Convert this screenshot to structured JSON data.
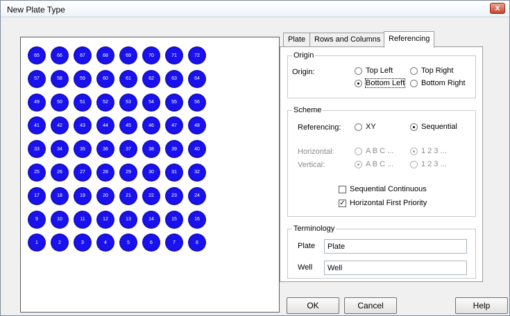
{
  "window": {
    "title": "New Plate Type",
    "close_label": "x"
  },
  "plate": {
    "rows": [
      [
        "65",
        "66",
        "67",
        "68",
        "69",
        "70",
        "71",
        "72"
      ],
      [
        "57",
        "58",
        "59",
        "60",
        "61",
        "62",
        "63",
        "64"
      ],
      [
        "49",
        "50",
        "51",
        "52",
        "53",
        "54",
        "55",
        "56"
      ],
      [
        "41",
        "42",
        "43",
        "44",
        "45",
        "46",
        "47",
        "48"
      ],
      [
        "33",
        "34",
        "35",
        "36",
        "37",
        "38",
        "39",
        "40"
      ],
      [
        "25",
        "26",
        "27",
        "28",
        "29",
        "30",
        "31",
        "32"
      ],
      [
        "17",
        "18",
        "19",
        "20",
        "21",
        "22",
        "23",
        "24"
      ],
      [
        "9",
        "10",
        "11",
        "12",
        "13",
        "14",
        "15",
        "16"
      ],
      [
        "1",
        "2",
        "3",
        "4",
        "5",
        "6",
        "7",
        "8"
      ]
    ],
    "well_color": "#1a12ee"
  },
  "tabs": [
    {
      "label": "Plate",
      "active": false
    },
    {
      "label": "Rows and Columns",
      "active": false
    },
    {
      "label": "Referencing",
      "active": true
    }
  ],
  "origin": {
    "group_label": "Origin",
    "label": "Origin:",
    "options": [
      {
        "label": "Top Left",
        "checked": false
      },
      {
        "label": "Top Right",
        "checked": false
      },
      {
        "label": "Bottom Left",
        "checked": true
      },
      {
        "label": "Bottom Right",
        "checked": false
      }
    ]
  },
  "scheme": {
    "group_label": "Scheme",
    "referencing_label": "Referencing:",
    "referencing_options": [
      {
        "label": "XY",
        "checked": false
      },
      {
        "label": "Sequential",
        "checked": true
      }
    ],
    "horizontal_label": "Horizontal:",
    "horizontal_options": [
      {
        "label": "A B C ...",
        "checked": false
      },
      {
        "label": "1 2 3 ...",
        "checked": true
      }
    ],
    "vertical_label": "Vertical:",
    "vertical_options": [
      {
        "label": "A B C ...",
        "checked": true
      },
      {
        "label": "1 2 3 ...",
        "checked": false
      }
    ],
    "sequential_continuous": {
      "label": "Sequential Continuous",
      "checked": false
    },
    "horizontal_first": {
      "label": "Horizontal First Priority",
      "checked": true
    }
  },
  "terminology": {
    "group_label": "Terminology",
    "plate_label": "Plate",
    "plate_value": "Plate",
    "well_label": "Well",
    "well_value": "Well"
  },
  "buttons": {
    "ok": "OK",
    "cancel": "Cancel",
    "help": "Help"
  }
}
